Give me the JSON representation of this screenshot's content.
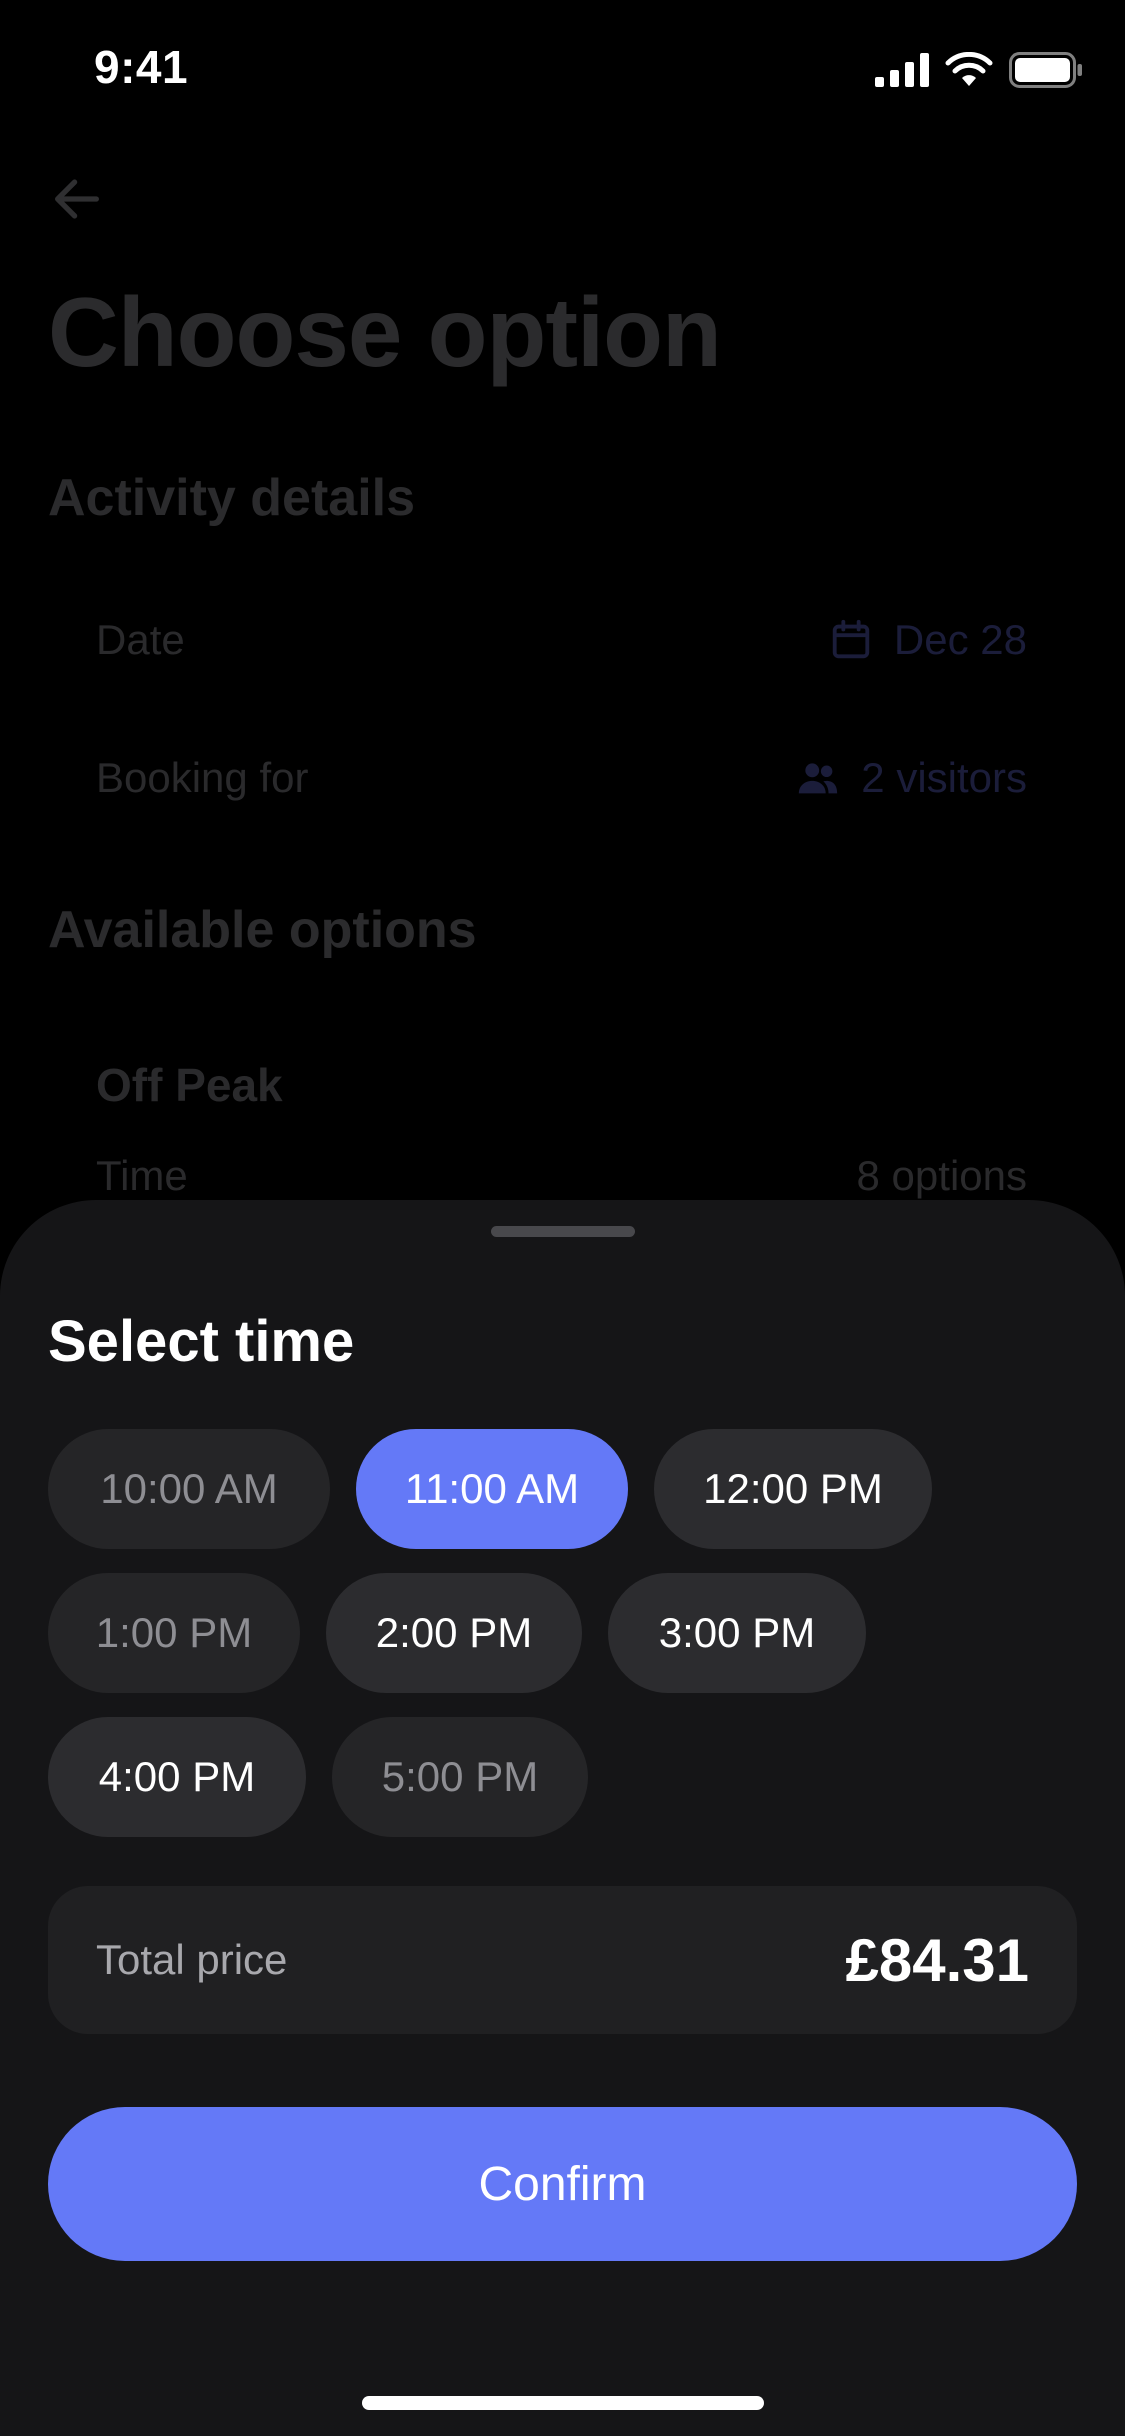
{
  "status_bar": {
    "time": "9:41"
  },
  "background": {
    "title": "Choose option",
    "activity_section_title": "Activity details",
    "date_label": "Date",
    "date_value": "Dec 28",
    "booking_label": "Booking for",
    "booking_value": "2 visitors",
    "options_section_title": "Available options",
    "option_name": "Off Peak",
    "time_label": "Time",
    "time_options_count": "8 options"
  },
  "sheet": {
    "title": "Select time",
    "times": [
      {
        "label": "10:00 AM",
        "state": "disabled"
      },
      {
        "label": "11:00 AM",
        "state": "selected"
      },
      {
        "label": "12:00 PM",
        "state": "available"
      },
      {
        "label": "1:00 PM",
        "state": "disabled"
      },
      {
        "label": "2:00 PM",
        "state": "available"
      },
      {
        "label": "3:00 PM",
        "state": "available"
      },
      {
        "label": "4:00 PM",
        "state": "available"
      },
      {
        "label": "5:00 PM",
        "state": "disabled"
      }
    ],
    "price_label": "Total price",
    "price_value": "£84.31",
    "confirm_label": "Confirm"
  },
  "icons": {
    "back": "arrow-left-icon",
    "date": "calendar-icon",
    "booking": "people-icon",
    "signal": "cellular-signal-icon",
    "wifi": "wifi-icon",
    "battery": "battery-icon"
  },
  "colors": {
    "accent": "#6479f7",
    "sheet_background": "#151517",
    "chip_background": "#2c2c2f"
  }
}
